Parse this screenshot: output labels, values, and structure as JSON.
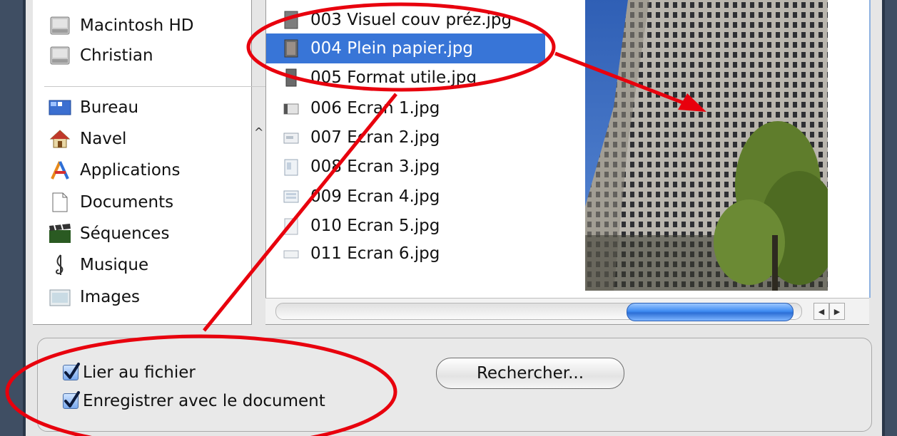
{
  "sidebar": {
    "devices": [
      {
        "label": "Macintosh HD",
        "icon": "hard-drive-icon"
      },
      {
        "label": "Christian",
        "icon": "hard-drive-icon"
      }
    ],
    "places": [
      {
        "label": "Bureau",
        "icon": "desktop-icon"
      },
      {
        "label": "Navel",
        "icon": "home-icon"
      },
      {
        "label": "Applications",
        "icon": "applications-icon"
      },
      {
        "label": "Documents",
        "icon": "documents-icon"
      },
      {
        "label": "Séquences",
        "icon": "movies-icon"
      },
      {
        "label": "Musique",
        "icon": "music-icon"
      },
      {
        "label": "Images",
        "icon": "pictures-icon"
      }
    ]
  },
  "files": [
    {
      "name": "003 Visuel couv préz.jpg",
      "selected": false
    },
    {
      "name": "004 Plein papier.jpg",
      "selected": true
    },
    {
      "name": "005 Format utile.jpg",
      "selected": false
    },
    {
      "name": "006 Ecran 1.jpg",
      "selected": false
    },
    {
      "name": "007 Ecran 2.jpg",
      "selected": false
    },
    {
      "name": "008 Ecran 3.jpg",
      "selected": false
    },
    {
      "name": "009 Ecran 4.jpg",
      "selected": false
    },
    {
      "name": "010 Ecran 5.jpg",
      "selected": false
    },
    {
      "name": "011 Ecran 6.jpg",
      "selected": false
    }
  ],
  "options": {
    "link_label": "Lier au fichier",
    "link_checked": true,
    "save_label": "Enregistrer avec le document",
    "save_checked": true,
    "search_button": "Rechercher..."
  },
  "colors": {
    "selection": "#3875d7",
    "annotation": "#e8000d",
    "frame": "#3f4e63"
  }
}
